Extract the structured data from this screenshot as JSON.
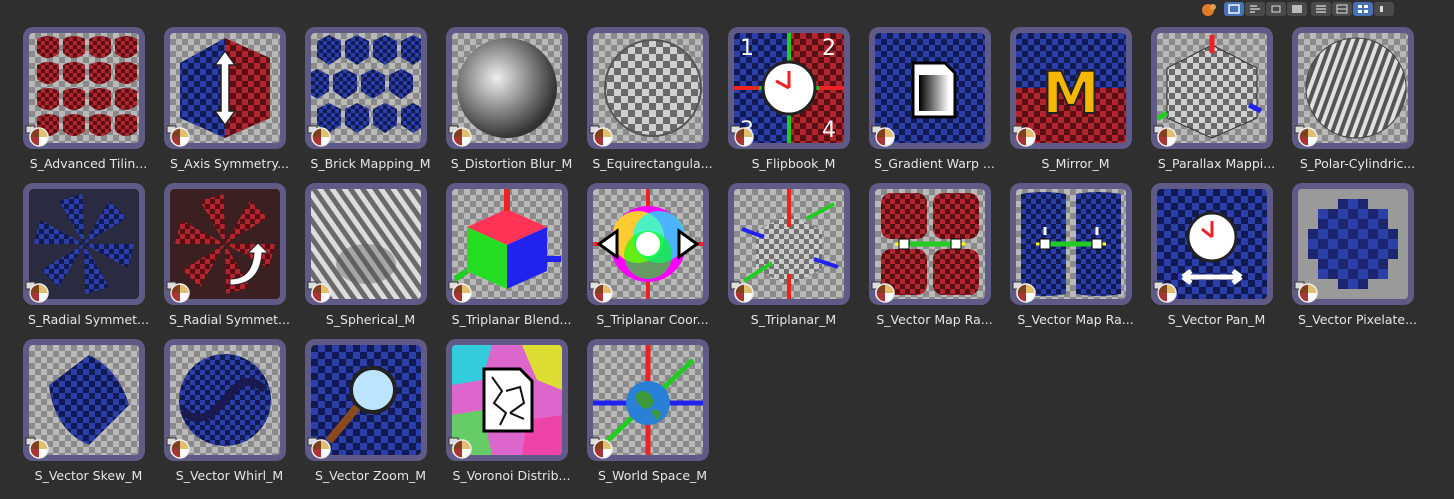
{
  "colors": {
    "background": "#2f2f2f",
    "tile_frame": "#5f5a86",
    "label_text": "#e6e6e6",
    "toolbar_active": "#4772b3"
  },
  "toolbar": {
    "icons": [
      "filter-icon",
      "thumbnail-size-icon",
      "sort-icon",
      "view-icon",
      "layout-icon",
      "list-icon",
      "grid-icon",
      "more-icon"
    ]
  },
  "assets": [
    {
      "label": "S_Advanced Tilin...",
      "icon": "red-tiles-icon"
    },
    {
      "label": "S_Axis Symmetry...",
      "icon": "axis-arrow-icon"
    },
    {
      "label": "S_Brick Mapping_M",
      "icon": "brick-blue-icon"
    },
    {
      "label": "S_Distortion Blur_M",
      "icon": "blur-sphere-icon"
    },
    {
      "label": "S_Equirectangula...",
      "icon": "checker-sphere-icon"
    },
    {
      "label": "S_Flipbook_M",
      "icon": "clock-icon",
      "numbers": [
        "1",
        "2",
        "3",
        "4"
      ]
    },
    {
      "label": "S_Gradient Warp ...",
      "icon": "gradient-doc-icon"
    },
    {
      "label": "S_Mirror_M",
      "icon": "mirror-m-icon",
      "letter": "M"
    },
    {
      "label": "S_Parallax Mappi...",
      "icon": "parallax-cube-icon"
    },
    {
      "label": "S_Polar-Cylindric...",
      "icon": "striped-sphere-icon"
    },
    {
      "label": "S_Radial Symmet...",
      "icon": "radial-blue-icon"
    },
    {
      "label": "S_Radial Symmet...",
      "icon": "radial-red-icon"
    },
    {
      "label": "S_Spherical_M",
      "icon": "stripe-sphere-icon"
    },
    {
      "label": "S_Triplanar Blend...",
      "icon": "rgb-cube-icon"
    },
    {
      "label": "S_Triplanar Coor...",
      "icon": "color-wheel-icon"
    },
    {
      "label": "S_Triplanar_M",
      "icon": "triplanar-axes-icon"
    },
    {
      "label": "S_Vector Map Ra...",
      "icon": "vector-map-red-icon"
    },
    {
      "label": "S_Vector Map Ra...",
      "icon": "vector-map-blue-icon"
    },
    {
      "label": "S_Vector Pan_M",
      "icon": "pan-clock-icon"
    },
    {
      "label": "S_Vector Pixelate...",
      "icon": "pixelate-icon"
    },
    {
      "label": "S_Vector Skew_M",
      "icon": "skew-cylinder-icon"
    },
    {
      "label": "S_Vector Whirl_M",
      "icon": "whirl-icon"
    },
    {
      "label": "S_Vector Zoom_M",
      "icon": "magnifier-icon"
    },
    {
      "label": "S_Voronoi Distrib...",
      "icon": "voronoi-doc-icon"
    },
    {
      "label": "S_World Space_M",
      "icon": "globe-axes-icon"
    }
  ]
}
